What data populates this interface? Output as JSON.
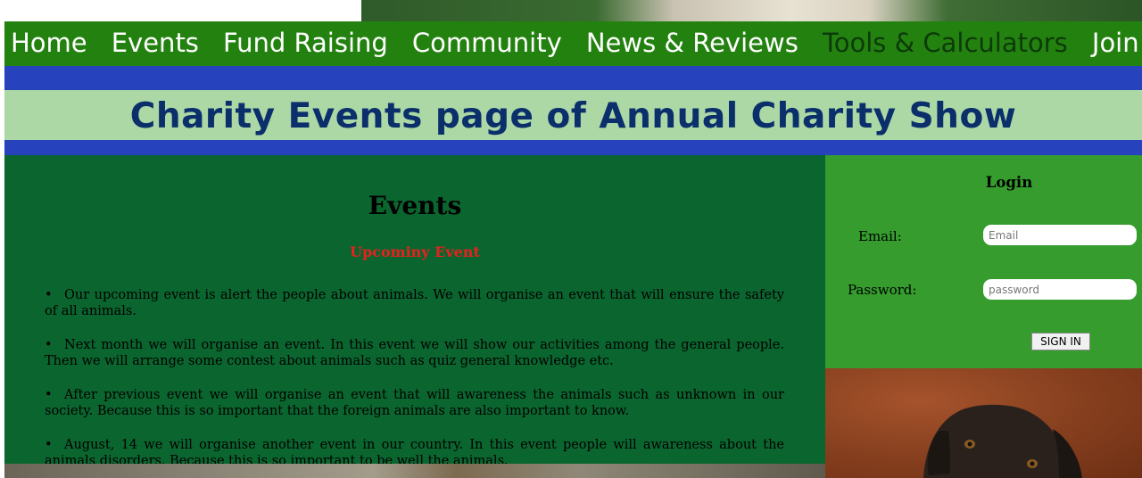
{
  "nav": {
    "items": [
      {
        "label": "Home"
      },
      {
        "label": "Events"
      },
      {
        "label": "Fund Raising"
      },
      {
        "label": "Community"
      },
      {
        "label": "News & Reviews"
      },
      {
        "label": "Tools & Calculators"
      },
      {
        "label": "Join Us Now"
      }
    ]
  },
  "header": {
    "title": "Charity Events page of Annual Charity Show"
  },
  "main": {
    "heading": "Events",
    "subheading": "Upcominy Event",
    "bullet_glyph": "•",
    "items": [
      {
        "text": "Our upcoming event is alert the people about animals. We will organise an event that will ensure the safety of all animals."
      },
      {
        "text": "Next month we will organise an event. In this event we will show our activities among the general people. Then we will arrange some contest about animals such as quiz general knowledge etc."
      },
      {
        "text": "After previous event we will organise an event that will awareness the animals such as unknown in our society. Because this is so important that the foreign animals are also important to know."
      },
      {
        "text": "August, 14 we will organise another event in our country. In this event people will awareness about the animals disorders. Because this is so important to be well the animals."
      }
    ]
  },
  "login": {
    "title": "Login",
    "email_label": "Email:",
    "email_placeholder": "Email",
    "password_label": "Password:",
    "password_placeholder": "password",
    "submit_label": "SIGN IN"
  },
  "colors": {
    "nav_bg": "#23820f",
    "band_blue": "#2642bd",
    "title_bg": "#acd8a6",
    "title_text": "#0b2f6b",
    "main_bg": "#0b652f",
    "login_bg": "#359c2d",
    "subheading": "#e8201e"
  }
}
